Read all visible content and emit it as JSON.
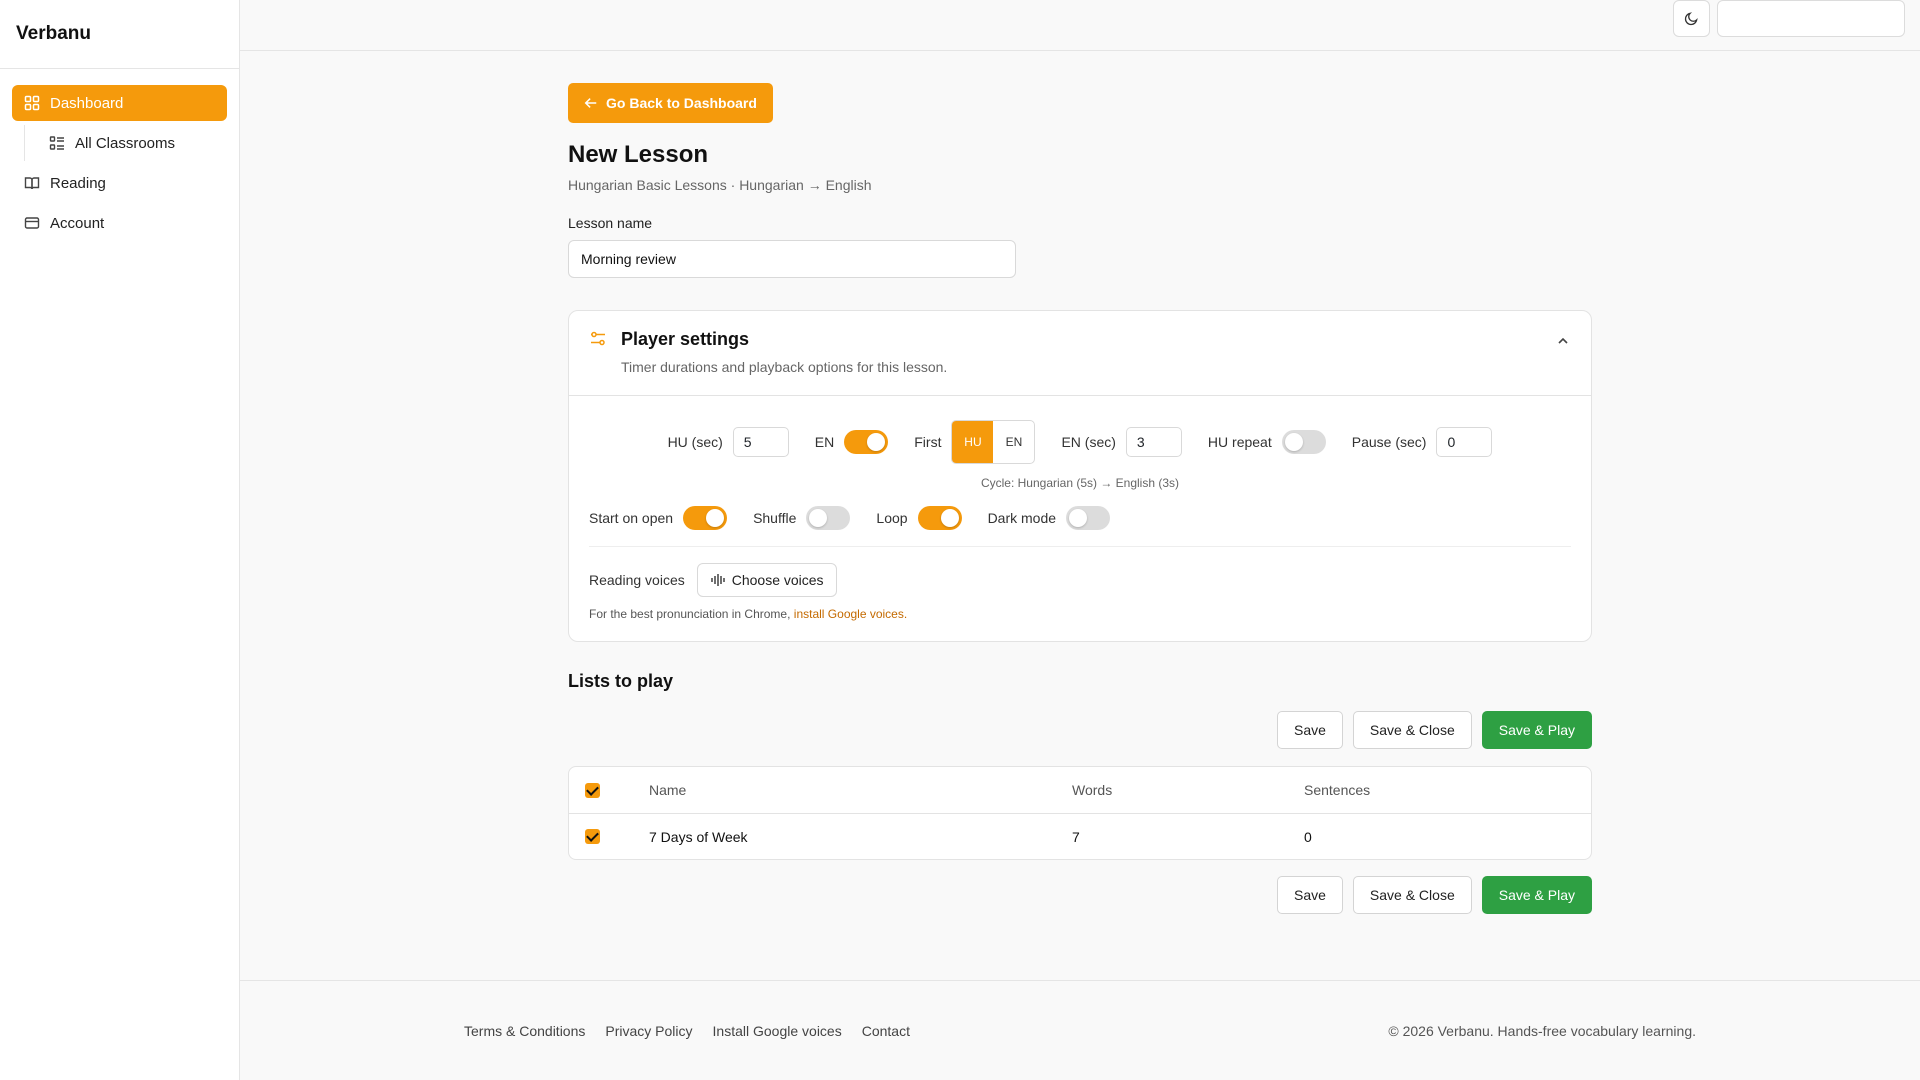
{
  "app": {
    "brand": "Verbanu"
  },
  "sidebar": {
    "items": [
      {
        "label": "Dashboard",
        "icon": "grid-icon"
      },
      {
        "label": "All Classrooms",
        "icon": "list-icon"
      },
      {
        "label": "Reading",
        "icon": "book-icon"
      },
      {
        "label": "Account",
        "icon": "card-icon"
      }
    ]
  },
  "topbar": {
    "theme_icon": "moon-icon"
  },
  "page": {
    "back_label": "Go Back to Dashboard",
    "title": "New Lesson",
    "subtitle": "Hungarian Basic Lessons · Hungarian → English",
    "lesson_name_label": "Lesson name",
    "lesson_name_value": "Morning review"
  },
  "player": {
    "title": "Player settings",
    "description": "Timer durations and playback options for this lesson.",
    "hu_sec_label": "HU (sec)",
    "hu_sec_value": "5",
    "en_label": "EN",
    "en_enabled": true,
    "first_label": "First",
    "first_options": [
      "HU",
      "EN"
    ],
    "first_selected": "HU",
    "en_sec_label": "EN (sec)",
    "en_sec_value": "3",
    "hu_repeat_label": "HU repeat",
    "hu_repeat_enabled": false,
    "pause_label": "Pause (sec)",
    "pause_value": "0",
    "cycle_text": "Cycle: Hungarian (5s) → English (3s)",
    "start_on_open_label": "Start on open",
    "start_on_open": true,
    "shuffle_label": "Shuffle",
    "shuffle": false,
    "loop_label": "Loop",
    "loop": true,
    "dark_mode_label": "Dark mode",
    "dark_mode": false,
    "voices_label": "Reading voices",
    "choose_voices_label": "Choose voices",
    "hint_text": "For the best pronunciation in Chrome,",
    "hint_link": "install Google voices."
  },
  "lists": {
    "title": "Lists to play",
    "save_label": "Save",
    "save_close_label": "Save & Close",
    "save_play_label": "Save & Play",
    "columns": [
      "Name",
      "Words",
      "Sentences"
    ],
    "rows": [
      {
        "name": "7 Days of Week",
        "words": "7",
        "sentences": "0",
        "checked": true
      }
    ]
  },
  "footer": {
    "links": [
      "Terms & Conditions",
      "Privacy Policy",
      "Install Google voices",
      "Contact"
    ],
    "copyright": "© 2026 Verbanu. Hands-free vocabulary learning."
  },
  "colors": {
    "accent": "#f59a0c",
    "success": "#2ea043",
    "link": "#c46a00"
  }
}
